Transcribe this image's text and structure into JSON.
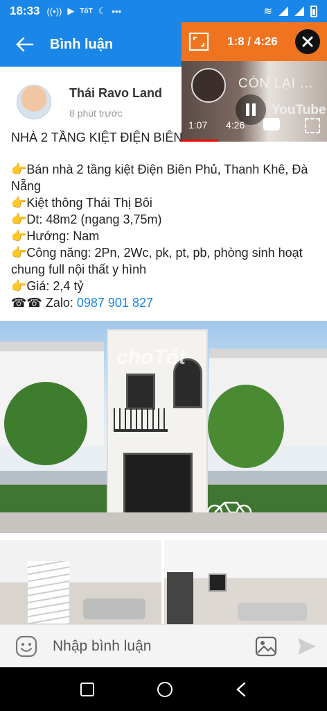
{
  "status_bar": {
    "time": "18:33",
    "app_icons": [
      "signal-icon",
      "play-icon",
      "tot-icon",
      "moon-icon",
      "more-icon"
    ],
    "tot_text": "TốT"
  },
  "app_bar": {
    "title": "Bình luận",
    "bg": "#1a86e8"
  },
  "video": {
    "counter": "1:8 / 4:26",
    "overlay_text": "CÒN LẠI ...",
    "elapsed": "1:07",
    "duration": "4:26",
    "brand": "YouTube",
    "accent": "#f0731f",
    "progress": 0.25
  },
  "post": {
    "author_name": "Thái Ravo Land",
    "time_ago": "8 phút trước",
    "heading": "NHÀ 2 TẦNG KIỆT ĐIỆN BIÊN",
    "lines": [
      "👉Bán nhà 2 tầng kiệt Điện Biên Phủ, Thanh Khê, Đà Nẵng",
      "👉Kiệt thông Thái Thị Bôi",
      "👉Dt: 48m2 (ngang 3,75m)",
      "👉Hướng: Nam",
      "👉Công năng: 2Pn, 2Wc, pk, pt, pb, phòng sinh hoạt chung full nội thất y hình",
      "👉Giá: 2,4 tỷ"
    ],
    "contact_label": "☎☎ Zalo: ",
    "phone": "0987 901 827",
    "watermark": "choTốt"
  },
  "comment_bar": {
    "placeholder": "Nhập bình luận"
  }
}
